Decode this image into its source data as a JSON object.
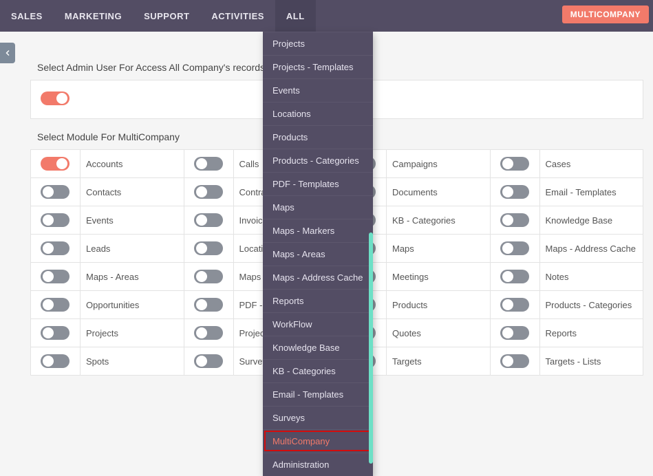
{
  "nav": {
    "items": [
      "SALES",
      "MARKETING",
      "SUPPORT",
      "ACTIVITIES",
      "ALL"
    ],
    "active_index": 4
  },
  "badge": "MULTICOMPANY",
  "section1": {
    "label": "Select Admin User For Access All Company's records"
  },
  "section2": {
    "label": "Select Module For MultiCompany"
  },
  "grid": [
    [
      {
        "label": "Accounts",
        "on": true
      },
      {
        "label": "Calls",
        "on": false
      },
      {
        "label": "Campaigns",
        "on": false
      },
      {
        "label": "Cases",
        "on": false
      }
    ],
    [
      {
        "label": "Contacts",
        "on": false
      },
      {
        "label": "Contracts",
        "on": false
      },
      {
        "label": "Documents",
        "on": false
      },
      {
        "label": "Email - Templates",
        "on": false
      }
    ],
    [
      {
        "label": "Events",
        "on": false
      },
      {
        "label": "Invoices",
        "on": false
      },
      {
        "label": "KB - Categories",
        "on": false
      },
      {
        "label": "Knowledge Base",
        "on": false
      }
    ],
    [
      {
        "label": "Leads",
        "on": false
      },
      {
        "label": "Locations",
        "on": false
      },
      {
        "label": "Maps",
        "on": false
      },
      {
        "label": "Maps - Address Cache",
        "on": false
      }
    ],
    [
      {
        "label": "Maps - Areas",
        "on": false
      },
      {
        "label": "Maps - Markers",
        "on": false
      },
      {
        "label": "Meetings",
        "on": false
      },
      {
        "label": "Notes",
        "on": false
      }
    ],
    [
      {
        "label": "Opportunities",
        "on": false
      },
      {
        "label": "PDF - Templates",
        "on": false
      },
      {
        "label": "Products",
        "on": false
      },
      {
        "label": "Products - Categories",
        "on": false
      }
    ],
    [
      {
        "label": "Projects",
        "on": false
      },
      {
        "label": "Projects - Templates",
        "on": false
      },
      {
        "label": "Quotes",
        "on": false
      },
      {
        "label": "Reports",
        "on": false
      }
    ],
    [
      {
        "label": "Spots",
        "on": false
      },
      {
        "label": "Surveys",
        "on": false
      },
      {
        "label": "Targets",
        "on": false
      },
      {
        "label": "Targets - Lists",
        "on": false
      }
    ]
  ],
  "dropdown": {
    "items": [
      "Projects",
      "Projects - Templates",
      "Events",
      "Locations",
      "Products",
      "Products - Categories",
      "PDF - Templates",
      "Maps",
      "Maps - Markers",
      "Maps - Areas",
      "Maps - Address Cache",
      "Reports",
      "WorkFlow",
      "Knowledge Base",
      "KB - Categories",
      "Email - Templates",
      "Surveys",
      "MultiCompany",
      "Administration"
    ],
    "highlight_index": 17
  },
  "colors": {
    "accent": "#f27a6a",
    "nav_bg": "#534d64",
    "toggle_off": "#8a8f98"
  }
}
